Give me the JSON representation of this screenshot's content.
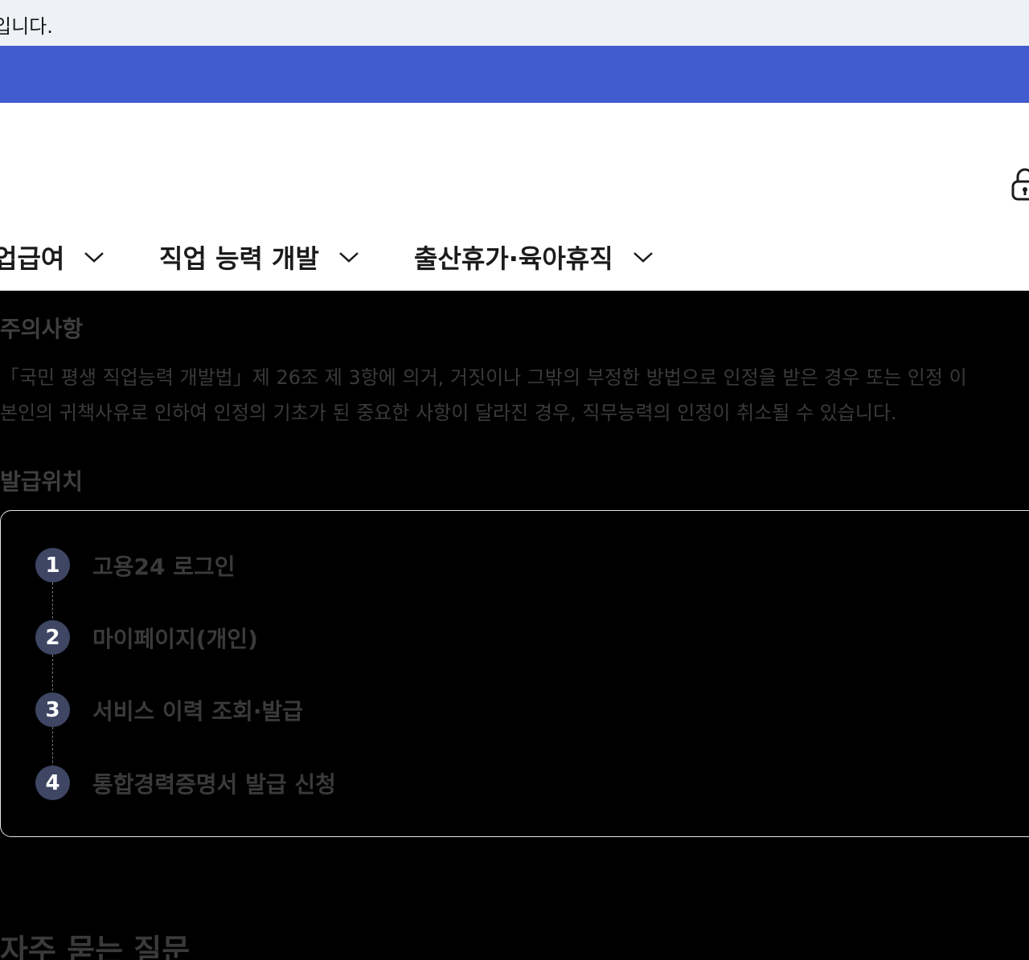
{
  "notice": {
    "text": "입니다."
  },
  "nav": {
    "items": [
      {
        "label": "업급여"
      },
      {
        "label": "직업 능력 개발"
      },
      {
        "label": "출산휴가·육아휴직"
      }
    ]
  },
  "caution": {
    "title": "주의사항",
    "line1": "「국민 평생 직업능력 개발법」제 26조 제 3항에 의거, 거짓이나 그밖의 부정한 방법으로 인정을 받은 경우 또는 인정 이",
    "line2": "본인의 귀책사유로 인하여 인정의 기초가 된 중요한 사항이 달라진 경우, 직무능력의 인정이 취소될 수 있습니다."
  },
  "issue": {
    "title": "발급위치",
    "steps": [
      {
        "num": "1",
        "label": "고용24 로그인"
      },
      {
        "num": "2",
        "label": "마이페이지(개인)"
      },
      {
        "num": "3",
        "label": "서비스 이력 조회·발급"
      },
      {
        "num": "4",
        "label": "통합경력증명서 발급 신청"
      }
    ]
  },
  "faq": {
    "title": "자주 묻는 질문"
  }
}
